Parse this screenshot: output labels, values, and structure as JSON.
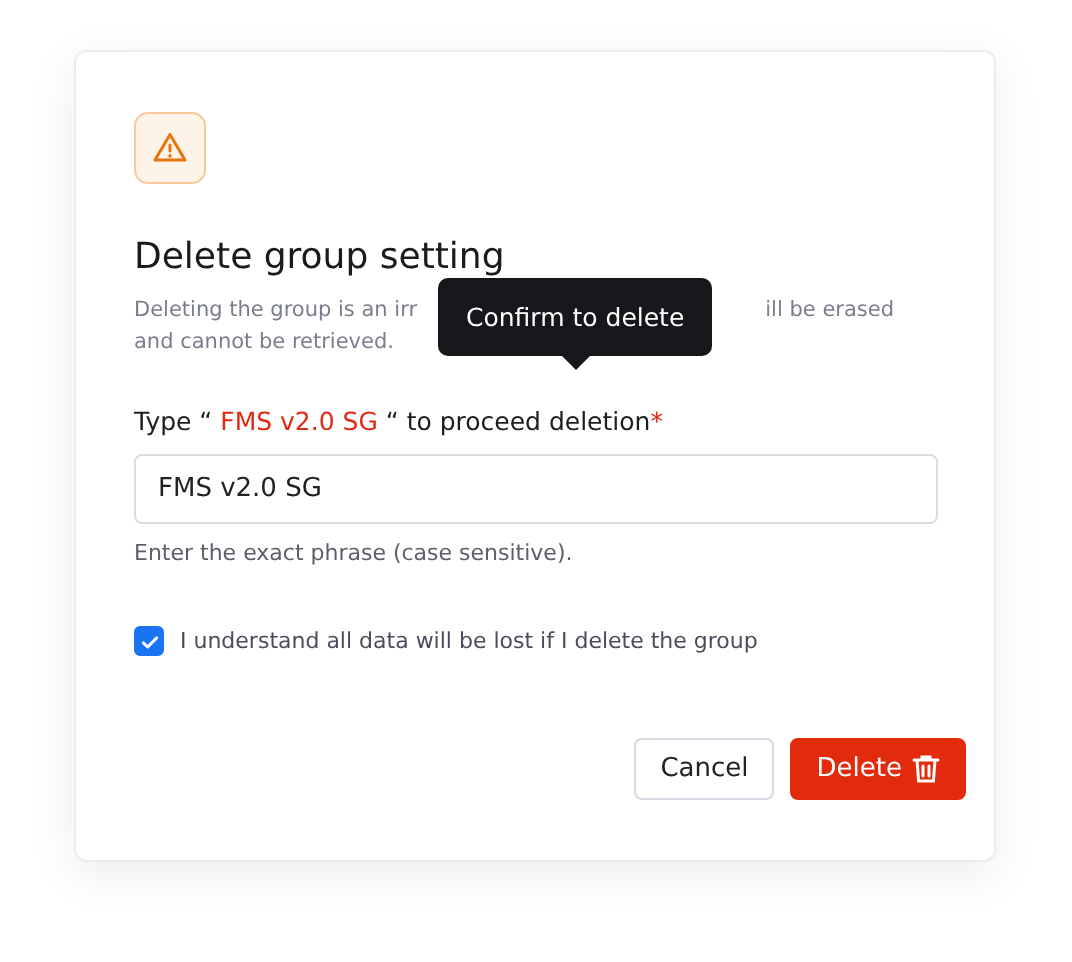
{
  "dialog": {
    "title": "Delete group setting",
    "description": {
      "line_1_start": "Deleting the group is an irr",
      "line_1_end": "ill be erased",
      "line_2": "and cannot be retrieved."
    },
    "tooltip": "Confirm to delete",
    "field_label": {
      "before": "Type “",
      "phrase": "FMS v2.0 SG",
      "after": "“ to proceed deletion",
      "required_mark": "*"
    },
    "input": {
      "value": "FMS v2.0 SG"
    },
    "hint": "Enter the exact phrase (case sensitive).",
    "checkbox": {
      "label": "I understand all data will be lost if I delete the group",
      "checked": true
    },
    "buttons": [
      {
        "label": "Cancel",
        "kind": "secondary"
      },
      {
        "label": "Delete",
        "kind": "danger"
      }
    ]
  }
}
